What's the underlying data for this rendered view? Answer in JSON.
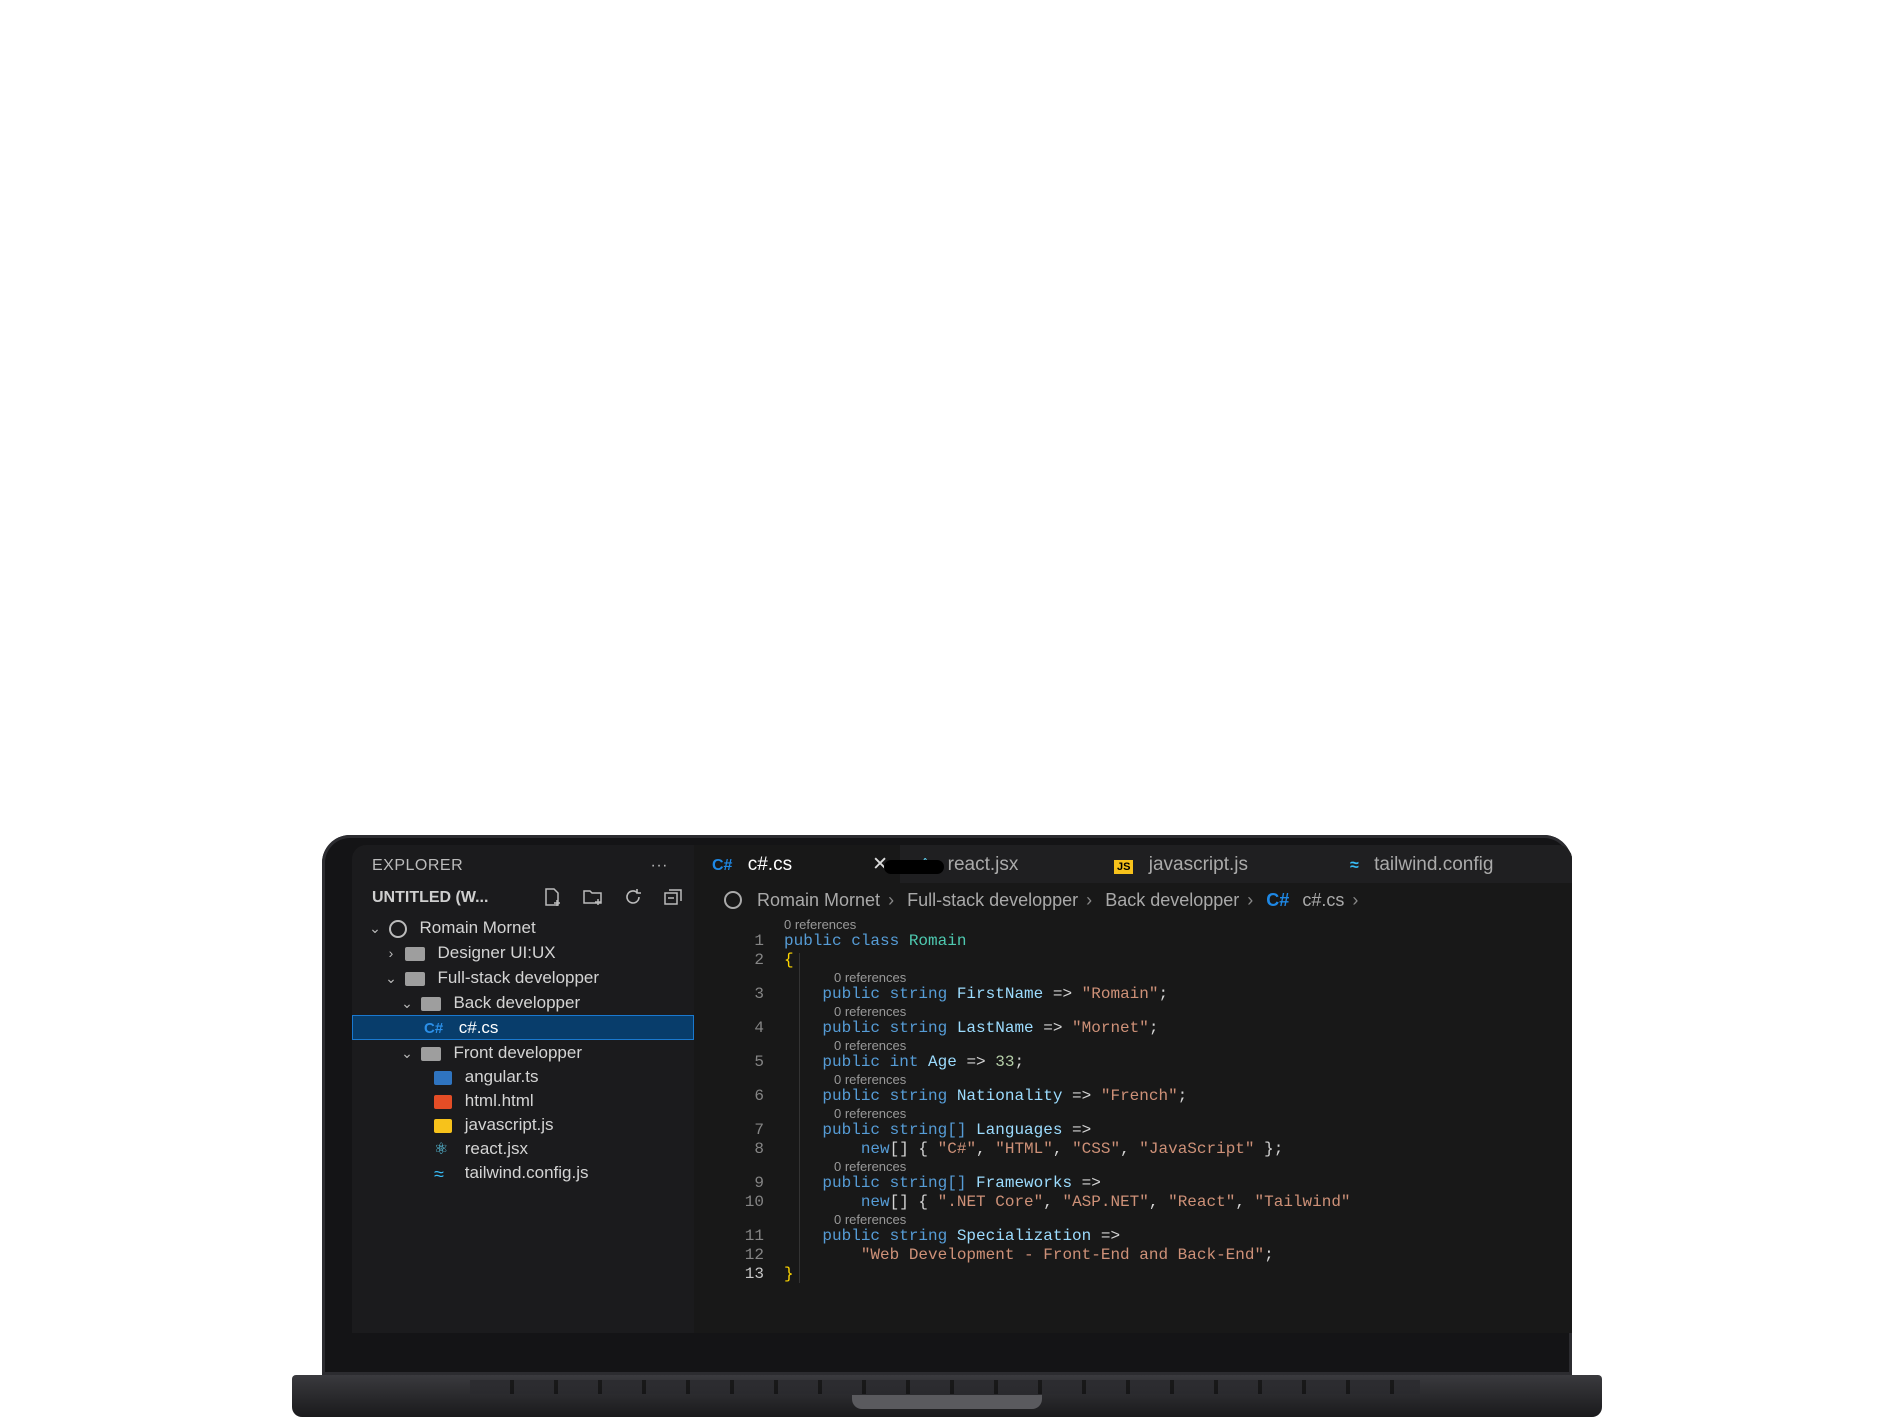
{
  "explorer": {
    "title": "EXPLORER",
    "more": "···",
    "workspace": "UNTITLED (W...",
    "tree": [
      {
        "label": "Romain Mornet",
        "chevron": "⌄",
        "icon": "circle-icon",
        "depth": 0
      },
      {
        "label": "Designer UI:UX",
        "chevron": "›",
        "icon": "folder-icon",
        "depth": 1
      },
      {
        "label": "Full-stack developper",
        "chevron": "⌄",
        "icon": "folder-open-icon",
        "depth": 1
      },
      {
        "label": "Back developper",
        "chevron": "⌄",
        "icon": "folder-open-icon",
        "depth": 2
      },
      {
        "label": "c#.cs",
        "chevron": "",
        "icon": "csharp-icon",
        "depth": 3,
        "selected": true
      },
      {
        "label": "Front developper",
        "chevron": "⌄",
        "icon": "folder-open-icon",
        "depth": 2
      },
      {
        "label": "angular.ts",
        "chevron": "",
        "icon": "typescript-icon",
        "depth": 3
      },
      {
        "label": "html.html",
        "chevron": "",
        "icon": "html5-icon",
        "depth": 3
      },
      {
        "label": "javascript.js",
        "chevron": "",
        "icon": "javascript-icon",
        "depth": 3
      },
      {
        "label": "react.jsx",
        "chevron": "",
        "icon": "react-icon",
        "depth": 3
      },
      {
        "label": "tailwind.config.js",
        "chevron": "",
        "icon": "tailwind-icon",
        "depth": 3
      }
    ]
  },
  "tabs": [
    {
      "label": "c#.cs",
      "icon_text": "C#",
      "icon_color": "#1e88e5",
      "active": true,
      "close": "✕"
    },
    {
      "label": "react.jsx",
      "icon_text": "⚛",
      "icon_color": "#61dafb"
    },
    {
      "label": "javascript.js",
      "icon_text": "JS",
      "icon_color": "#f7c21b"
    },
    {
      "label": "tailwind.config",
      "icon_text": "≈",
      "icon_color": "#38bdf8"
    }
  ],
  "breadcrumb": [
    "Romain Mornet",
    "Full-stack developper",
    "Back developper",
    "c#.cs"
  ],
  "code": {
    "references_label": "0 references",
    "lines": [
      {
        "n": "1",
        "ref": true,
        "tokens": [
          [
            "kw",
            "public class "
          ],
          [
            "cls",
            "Romain"
          ]
        ]
      },
      {
        "n": "2",
        "tokens": [
          [
            "brace",
            "{"
          ]
        ]
      },
      {
        "n": "3",
        "ref": true,
        "tokens": [
          [
            "kw",
            "    public string "
          ],
          [
            "prop",
            "FirstName"
          ],
          [
            "op",
            " => "
          ],
          [
            "str",
            "\"Romain\""
          ],
          [
            "op",
            ";"
          ]
        ]
      },
      {
        "n": "4",
        "ref": true,
        "tokens": [
          [
            "kw",
            "    public string "
          ],
          [
            "prop",
            "LastName"
          ],
          [
            "op",
            " => "
          ],
          [
            "str",
            "\"Mornet\""
          ],
          [
            "op",
            ";"
          ]
        ]
      },
      {
        "n": "5",
        "ref": true,
        "tokens": [
          [
            "kw",
            "    public int "
          ],
          [
            "prop",
            "Age"
          ],
          [
            "op",
            " => "
          ],
          [
            "num",
            "33"
          ],
          [
            "op",
            ";"
          ]
        ]
      },
      {
        "n": "6",
        "ref": true,
        "tokens": [
          [
            "kw",
            "    public string "
          ],
          [
            "prop",
            "Nationality"
          ],
          [
            "op",
            " => "
          ],
          [
            "str",
            "\"French\""
          ],
          [
            "op",
            ";"
          ]
        ]
      },
      {
        "n": "7",
        "ref": true,
        "tokens": [
          [
            "kw",
            "    public string[] "
          ],
          [
            "prop",
            "Languages"
          ],
          [
            "op",
            " =>"
          ]
        ]
      },
      {
        "n": "8",
        "tokens": [
          [
            "kw",
            "        new"
          ],
          [
            "op",
            "[] { "
          ],
          [
            "str",
            "\"C#\""
          ],
          [
            "op",
            ", "
          ],
          [
            "str",
            "\"HTML\""
          ],
          [
            "op",
            ", "
          ],
          [
            "str",
            "\"CSS\""
          ],
          [
            "op",
            ", "
          ],
          [
            "str",
            "\"JavaScript\""
          ],
          [
            "op",
            " };"
          ]
        ]
      },
      {
        "n": "9",
        "ref": true,
        "tokens": [
          [
            "kw",
            "    public string[] "
          ],
          [
            "prop",
            "Frameworks"
          ],
          [
            "op",
            " =>"
          ]
        ]
      },
      {
        "n": "10",
        "tokens": [
          [
            "kw",
            "        new"
          ],
          [
            "op",
            "[] { "
          ],
          [
            "str",
            "\".NET Core\""
          ],
          [
            "op",
            ", "
          ],
          [
            "str",
            "\"ASP.NET\""
          ],
          [
            "op",
            ", "
          ],
          [
            "str",
            "\"React\""
          ],
          [
            "op",
            ", "
          ],
          [
            "str",
            "\"Tailwind\""
          ]
        ]
      },
      {
        "n": "11",
        "ref": true,
        "tokens": [
          [
            "kw",
            "    public string "
          ],
          [
            "prop",
            "Specialization"
          ],
          [
            "op",
            " =>"
          ]
        ]
      },
      {
        "n": "12",
        "tokens": [
          [
            "str",
            "        \"Web Development - Front-End and Back-End\""
          ],
          [
            "op",
            ";"
          ]
        ]
      },
      {
        "n": "13",
        "current": true,
        "tokens": [
          [
            "brace",
            "}"
          ]
        ]
      }
    ]
  }
}
